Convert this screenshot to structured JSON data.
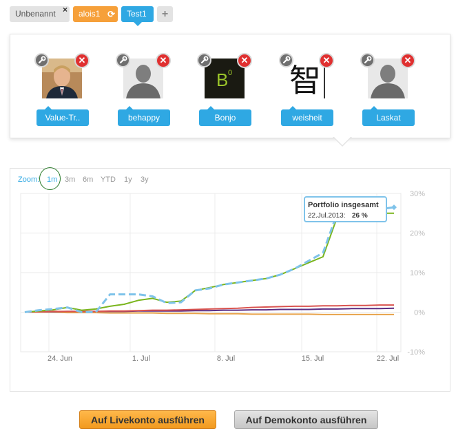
{
  "tabs": [
    {
      "label": "Unbenannt",
      "close": "×"
    },
    {
      "label": "alois1"
    },
    {
      "label": "Test1"
    },
    {
      "label": "+"
    }
  ],
  "members": [
    {
      "name": "Value-Tr..",
      "avatar": "photo"
    },
    {
      "name": "behappy",
      "avatar": "silhouette"
    },
    {
      "name": "Bonjo",
      "avatar": "b0-logo",
      "logo_text": "B",
      "logo_sup": "0"
    },
    {
      "name": "weisheit",
      "avatar": "kanji",
      "kanji": "智"
    },
    {
      "name": "Laskat",
      "avatar": "silhouette"
    }
  ],
  "member_close_glyph": "✕",
  "chart": {
    "zoom_label": "Zoom:",
    "zoom_options": [
      "1m",
      "3m",
      "6m",
      "YTD",
      "1y",
      "3y"
    ],
    "tooltip": {
      "title": "Portfolio insgesamt",
      "date": "22.Jul.2013:",
      "value": "26 %"
    }
  },
  "chart_data": {
    "type": "line",
    "x_ticks": [
      "24. Jun",
      "1. Jul",
      "8. Jul",
      "15. Jul",
      "22. Jul"
    ],
    "y_ticks": [
      "30%",
      "20%",
      "10%",
      "0%",
      "-10%"
    ],
    "ylim": [
      -10,
      30
    ],
    "grid": true,
    "colors": {
      "portfolio": "#7fc3ea",
      "green": "#7ab51d",
      "red": "#d9534f",
      "purple": "#5b2c83",
      "orange": "#e8a24a"
    },
    "series": [
      {
        "key": "portfolio",
        "dashed": true,
        "values": [
          0,
          0.5,
          0.8,
          1.2,
          0,
          0,
          4.5,
          4.5,
          4.5,
          4.0,
          2.3,
          2.5,
          5.5,
          6.0,
          7.0,
          7.5,
          8.0,
          8.5,
          9.5,
          11.0,
          13.0,
          15.0,
          25.0,
          26.0,
          26.0,
          26.0,
          26.5
        ]
      },
      {
        "key": "green",
        "values": [
          0,
          0.3,
          0.6,
          1.2,
          0.5,
          0.8,
          1.5,
          2.0,
          3.0,
          3.5,
          2.5,
          2.8,
          5.5,
          6.2,
          7.0,
          7.5,
          8.0,
          8.5,
          9.5,
          11.0,
          12.5,
          14.0,
          24.0,
          24.5,
          25.0,
          25.0,
          25.0
        ]
      },
      {
        "key": "red",
        "values": [
          0,
          0.1,
          0.2,
          0.2,
          0.2,
          0.2,
          0.3,
          0.3,
          0.4,
          0.5,
          0.5,
          0.6,
          0.7,
          0.8,
          0.9,
          1.0,
          1.2,
          1.3,
          1.4,
          1.5,
          1.5,
          1.6,
          1.6,
          1.7,
          1.7,
          1.8,
          1.8
        ]
      },
      {
        "key": "purple",
        "values": [
          0,
          0.1,
          0.1,
          0.2,
          0.2,
          0.2,
          0.2,
          0.2,
          0.3,
          0.3,
          0.3,
          0.3,
          0.4,
          0.4,
          0.5,
          0.5,
          0.6,
          0.6,
          0.7,
          0.7,
          0.7,
          0.8,
          0.8,
          0.9,
          0.9,
          0.9,
          1.0
        ]
      },
      {
        "key": "orange",
        "values": [
          0,
          0,
          0,
          -0.1,
          -0.1,
          -0.1,
          -0.2,
          -0.2,
          -0.2,
          -0.2,
          -0.3,
          -0.3,
          -0.3,
          -0.4,
          -0.4,
          -0.4,
          -0.5,
          -0.5,
          -0.5,
          -0.5,
          -0.5,
          -0.6,
          -0.6,
          -0.6,
          -0.6,
          -0.6,
          -0.6
        ]
      }
    ]
  },
  "buttons": {
    "live": "Auf Livekonto ausführen",
    "demo": "Auf Demokonto ausführen"
  }
}
